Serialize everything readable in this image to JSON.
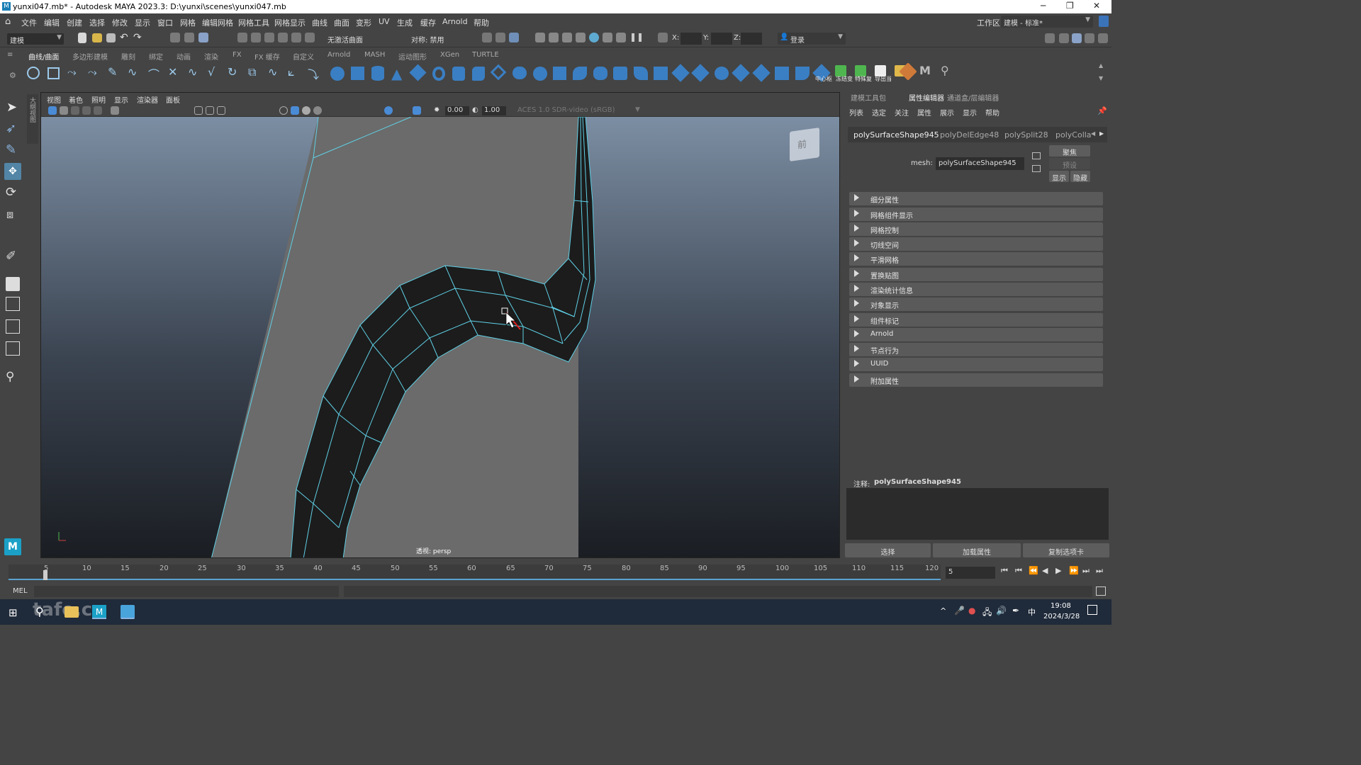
{
  "window": {
    "title": "yunxi047.mb* - Autodesk MAYA 2023.3: D:\\yunxi\\scenes\\yunxi047.mb"
  },
  "menubar": {
    "items": [
      "文件",
      "编辑",
      "创建",
      "选择",
      "修改",
      "显示",
      "窗口",
      "网格",
      "编辑网格",
      "网格工具",
      "网格显示",
      "曲线",
      "曲面",
      "变形",
      "UV",
      "生成",
      "缓存",
      "Arnold",
      "帮助"
    ],
    "workspace_label": "工作区:",
    "workspace_value": "建模 - 标准*"
  },
  "statusline": {
    "mode_value": "建模",
    "live_surface": "无激活曲面",
    "symmetry": "对称: 禁用",
    "x_label": "X:",
    "y_label": "Y:",
    "z_label": "Z:",
    "login": "登录"
  },
  "shelf": {
    "tabs": [
      "曲线/曲面",
      "多边形建模",
      "雕刻",
      "绑定",
      "动画",
      "渲染",
      "FX",
      "FX 缓存",
      "自定义",
      "Arnold",
      "MASH",
      "运动图形",
      "XGen",
      "TURTLE"
    ],
    "active_tab": 0,
    "right_labels": [
      "中心枢",
      "冻结变",
      "特殊复",
      "导出当"
    ]
  },
  "left_sidebar_tab": "大纲视图",
  "viewport": {
    "menu": [
      "视图",
      "着色",
      "照明",
      "显示",
      "渲染器",
      "面板"
    ],
    "gamma_value": "0.00",
    "exposure_value": "1.00",
    "color_space": "ACES 1.0 SDR-video (sRGB)",
    "camera_label": "透视: persp",
    "viewcube_label": "前"
  },
  "right_panel": {
    "tabs": [
      "建模工具包",
      "属性编辑器",
      "通道盒/层编辑器"
    ],
    "active_tab": 1,
    "menu": [
      "列表",
      "选定",
      "关注",
      "属性",
      "展示",
      "显示",
      "帮助"
    ],
    "node_tabs": [
      "polySurfaceShape945",
      "polyDelEdge48",
      "polySplit28",
      "polyCollap"
    ],
    "mesh_label": "mesh:",
    "mesh_value": "polySurfaceShape945",
    "focus_btn": "聚焦",
    "preset_btn": "预设",
    "show_btn": "显示",
    "hide_btn": "隐藏",
    "sections": [
      "细分属性",
      "网格组件显示",
      "网格控制",
      "切线空间",
      "平滑网格",
      "置换贴图",
      "渲染统计信息",
      "对象显示",
      "组件标记",
      "Arnold",
      "节点行为",
      "UUID",
      "附加属性"
    ],
    "notes_label": "注释:",
    "notes_value": "polySurfaceShape945",
    "bottom_buttons": [
      "选择",
      "加载属性",
      "复制选项卡"
    ]
  },
  "timeline": {
    "ticks": [
      "5",
      "10",
      "15",
      "20",
      "25",
      "30",
      "35",
      "40",
      "45",
      "50",
      "55",
      "60",
      "65",
      "70",
      "75",
      "80",
      "85",
      "90",
      "95",
      "100",
      "105",
      "110",
      "115",
      "120"
    ],
    "current_frame": "5"
  },
  "cmdline": {
    "label": "MEL"
  },
  "taskbar": {
    "time": "19:08",
    "date": "2024/3/28",
    "ime": "中",
    "watermark": "tafe.cc"
  },
  "colors": {
    "ui_bg": "#444444",
    "wire": "#5fd0e6",
    "selected_edge": "#e02020",
    "section_bg": "#5a5a5a"
  }
}
